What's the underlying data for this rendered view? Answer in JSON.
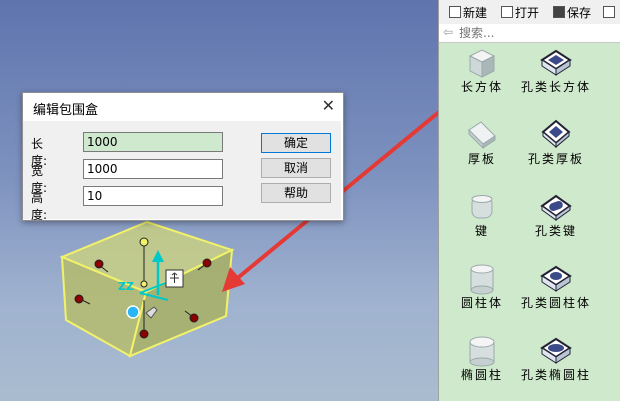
{
  "dialog": {
    "title": "编辑包围盒",
    "close_glyph": "✕",
    "fields": [
      {
        "label": "长度:",
        "value": "1000"
      },
      {
        "label": "宽度:",
        "value": "1000"
      },
      {
        "label": "高度:",
        "value": "10"
      }
    ],
    "ok_label": "确定",
    "cancel_label": "取消",
    "help_label": "帮助"
  },
  "toolbar": {
    "new_label": "新建",
    "open_label": "打开",
    "save_label": "保存"
  },
  "search": {
    "placeholder": "搜索..."
  },
  "shapes": [
    {
      "label": "长方体",
      "icon": "cuboid-icon"
    },
    {
      "label": "孔类长方体",
      "icon": "hole-cuboid-icon"
    },
    {
      "label": "厚板",
      "icon": "thick-plate-icon"
    },
    {
      "label": "孔类厚板",
      "icon": "hole-thick-plate-icon"
    },
    {
      "label": "键",
      "icon": "key-icon"
    },
    {
      "label": "孔类键",
      "icon": "hole-key-icon"
    },
    {
      "label": "圆柱体",
      "icon": "cylinder-icon"
    },
    {
      "label": "孔类圆柱体",
      "icon": "hole-cylinder-icon"
    },
    {
      "label": "椭圆柱",
      "icon": "elliptic-cylinder-icon"
    },
    {
      "label": "孔类椭圆柱",
      "icon": "hole-elliptic-cylinder-icon"
    }
  ],
  "colors": {
    "arrow": "#e53935",
    "box_face": "#c9d06a",
    "box_edge": "#f2f26a",
    "handle": "#8b0000",
    "axis": "#00c8c8",
    "panel_bg": "#cfe9cc",
    "active_field": "#cfe9cf"
  }
}
